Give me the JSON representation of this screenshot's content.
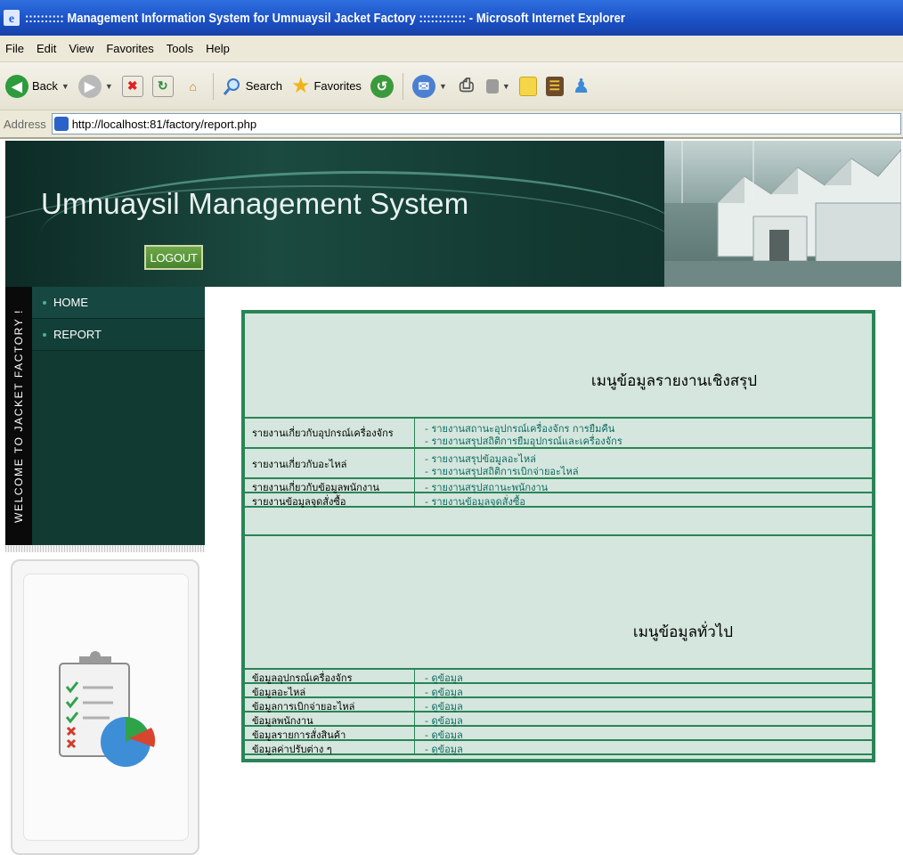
{
  "window": {
    "title": ":::::::::: Management Information System for Umnuaysil Jacket Factory :::::::::::: - Microsoft Internet Explorer"
  },
  "menubar": {
    "items": [
      "File",
      "Edit",
      "View",
      "Favorites",
      "Tools",
      "Help"
    ]
  },
  "toolbar": {
    "back_label": "Back",
    "search_label": "Search",
    "favorites_label": "Favorites"
  },
  "addressbar": {
    "label": "Address",
    "url": "http://localhost:81/factory/report.php"
  },
  "banner": {
    "title": "Umnuaysil Management System",
    "logout_label": "LOGOUT"
  },
  "sidebar": {
    "vertical_text": "WELCOME TO JACKET FACTORY !",
    "items": [
      "HOME",
      "REPORT"
    ]
  },
  "summary_menu": {
    "title": "เมนูข้อมูลรายงานเชิงสรุป",
    "rows": [
      {
        "label": "รายงานเกี่ยวกับอุปกรณ์เครื่องจักร",
        "links": [
          "- รายงานสถานะอุปกรณ์เครื่องจักร การยืมคืน",
          "- รายงานสรุปสถิติการยืมอุปกรณ์และเครื่องจักร"
        ]
      },
      {
        "label": "รายงานเกี่ยวกับอะไหล่",
        "links": [
          "- รายงานสรุปข้อมูลอะไหล่",
          "- รายงานสรุปสถิติการเบิกจ่ายอะไหล่"
        ]
      },
      {
        "label": "รายงานเกี่ยวกับข้อมูลพนักงาน",
        "links": [
          "- รายงานสรุปสถานะพนักงาน"
        ]
      },
      {
        "label": "รายงานข้อมูลจุดสั่งซื้อ",
        "links": [
          "- รายงานข้อมูลจุดสั่งซื้อ"
        ]
      }
    ]
  },
  "general_menu": {
    "title": "เมนูข้อมูลทั่วไป",
    "rows": [
      {
        "label": "ข้อมูลอุปกรณ์เครื่องจักร",
        "link": "- ดูข้อมูล"
      },
      {
        "label": "ข้อมูลอะไหล่",
        "link": "- ดูข้อมูล"
      },
      {
        "label": "ข้อมูลการเบิกจ่ายอะไหล่",
        "link": "- ดูข้อมูล"
      },
      {
        "label": "ข้อมูลพนักงาน",
        "link": "- ดูข้อมูล"
      },
      {
        "label": "ข้อมูลรายการสั่งสินค้า",
        "link": "- ดูข้อมูล"
      },
      {
        "label": "ข้อมูลค่าปรับต่าง ๆ",
        "link": "- ดูข้อมูล"
      }
    ]
  },
  "colors": {
    "table_border": "#2b8457",
    "table_bg": "#d4e6dd",
    "link": "#0d6a61",
    "sidebar_bg": "#113a33",
    "logout_bg": "#5a9a3a"
  },
  "icons": [
    "ie-logo-icon",
    "back-icon",
    "forward-icon",
    "stop-icon",
    "refresh-icon",
    "home-icon",
    "search-icon",
    "favorites-icon",
    "history-icon",
    "mail-icon",
    "print-icon",
    "page-icon",
    "clipboard-chart-icon"
  ]
}
